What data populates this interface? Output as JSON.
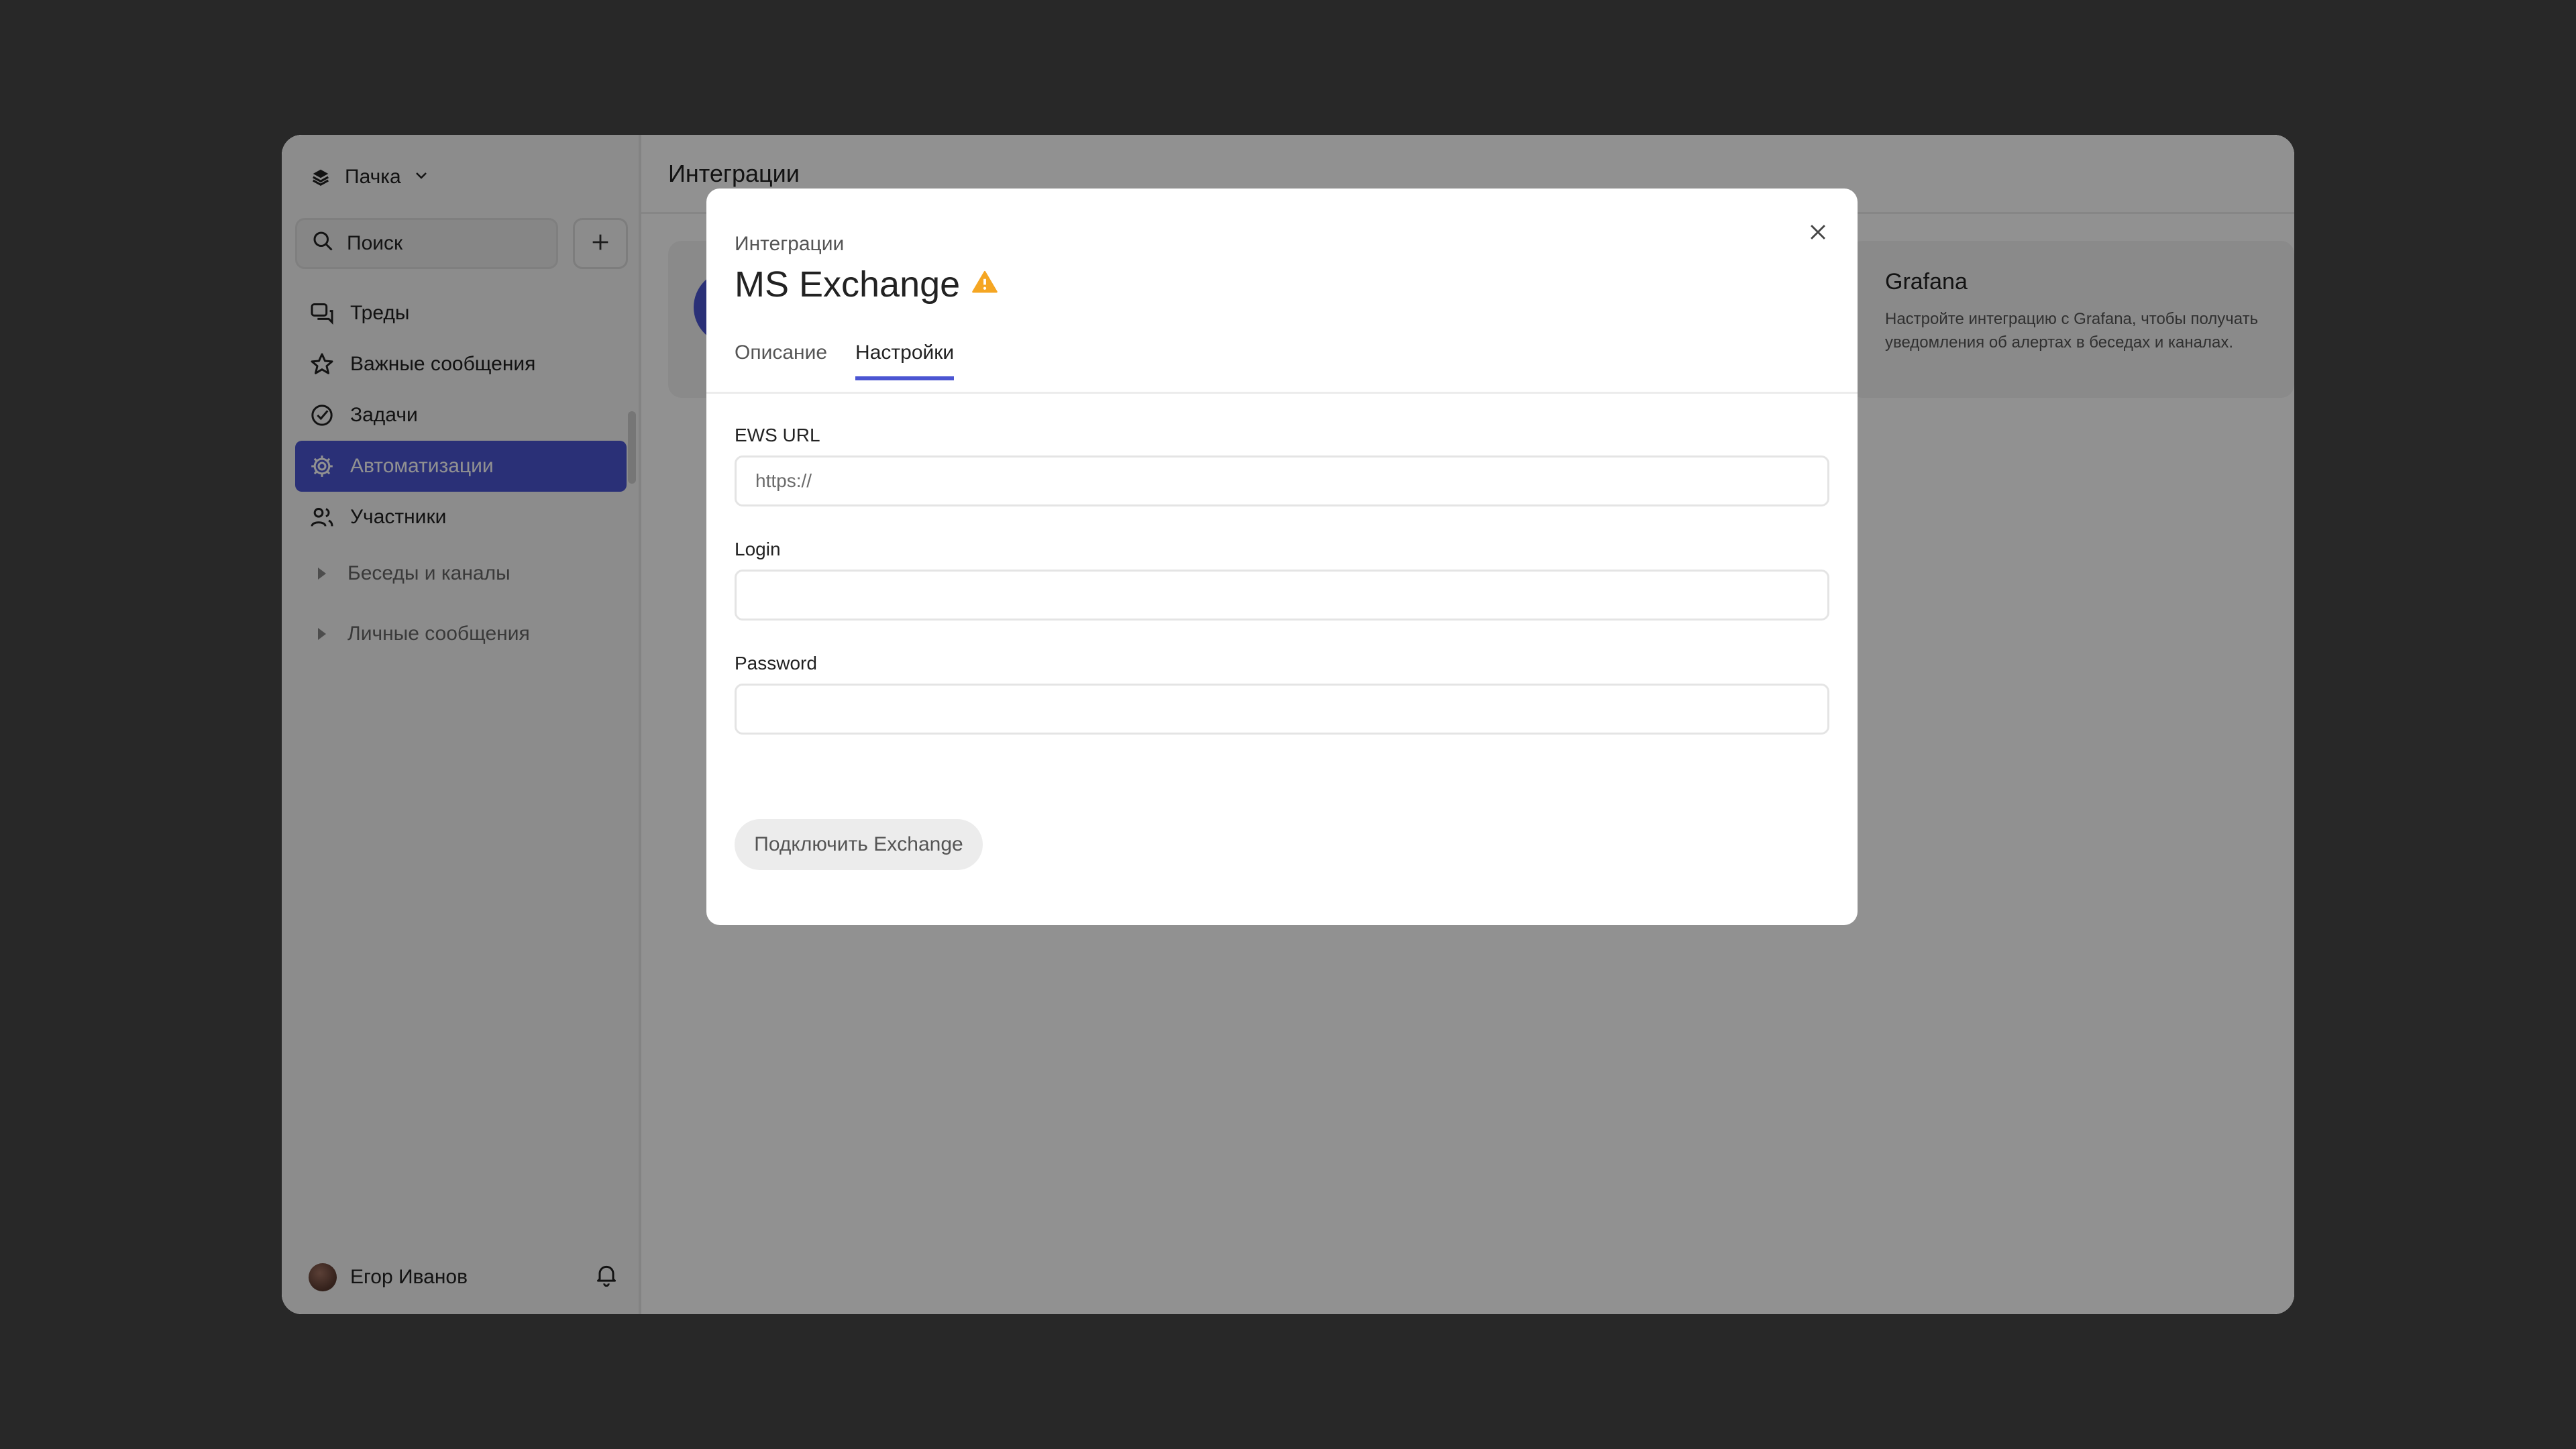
{
  "sidebar": {
    "workspace_name": "Пачка",
    "search_placeholder": "Поиск",
    "nav": [
      {
        "label": "Треды",
        "icon": "threads-icon"
      },
      {
        "label": "Важные сообщения",
        "icon": "star-icon"
      },
      {
        "label": "Задачи",
        "icon": "check-circle-icon"
      },
      {
        "label": "Автоматизации",
        "icon": "gear-icon",
        "active": true
      },
      {
        "label": "Участники",
        "icon": "users-icon"
      }
    ],
    "sections": [
      {
        "label": "Беседы и каналы"
      },
      {
        "label": "Личные сообщения"
      }
    ],
    "user_name": "Егор Иванов"
  },
  "main": {
    "title": "Интеграции",
    "cards": [
      {
        "title": "Grafana",
        "description": "Настройте интеграцию с Grafana, чтобы получать уведомления об алертах в беседах и каналах."
      }
    ]
  },
  "modal": {
    "subtitle": "Интеграции",
    "title": "MS Exchange",
    "tabs": [
      {
        "label": "Описание",
        "active": false
      },
      {
        "label": "Настройки",
        "active": true
      }
    ],
    "fields": [
      {
        "label": "EWS URL",
        "placeholder": "https://",
        "value": ""
      },
      {
        "label": "Login",
        "placeholder": "",
        "value": ""
      },
      {
        "label": "Password",
        "placeholder": "",
        "value": ""
      }
    ],
    "connect_button": "Подключить Exchange"
  },
  "colors": {
    "accent": "#4b55d2",
    "warning": "#f5a623",
    "backdrop": "#282828"
  }
}
